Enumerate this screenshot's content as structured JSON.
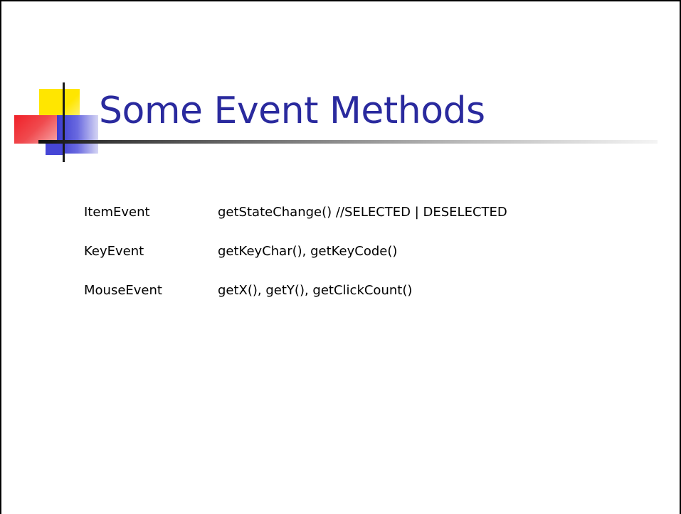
{
  "slide": {
    "title": "Some Event Methods",
    "rows": [
      {
        "event": "ItemEvent",
        "methods": "getStateChange()  //SELECTED | DESELECTED"
      },
      {
        "event": "KeyEvent",
        "methods": "getKeyChar(), getKeyCode()"
      },
      {
        "event": "MouseEvent",
        "methods": "getX(), getY(), getClickCount()"
      }
    ]
  },
  "colors": {
    "title": "#2a2a9e",
    "logo_yellow": "#ffe600",
    "logo_red": "#f02028",
    "logo_blue": "#3a3ad0"
  },
  "icons": {
    "corner_logo": "colored-squares-logo-icon"
  }
}
